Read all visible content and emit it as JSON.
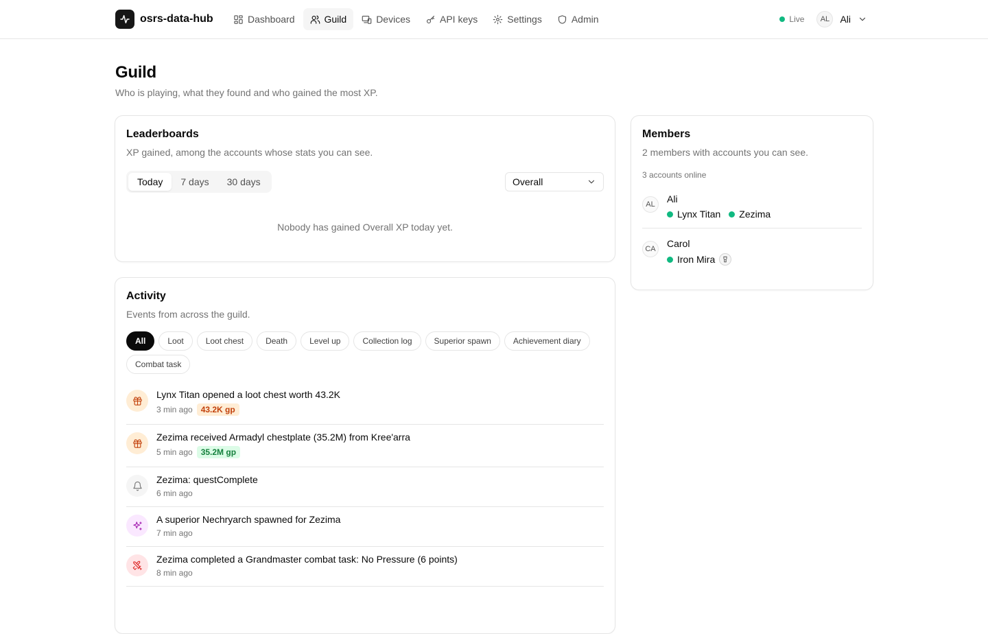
{
  "brand": {
    "name": "osrs-data-hub",
    "logo_icon": "activity-icon"
  },
  "nav": [
    {
      "label": "Dashboard",
      "icon": "grid-icon",
      "active": false
    },
    {
      "label": "Guild",
      "icon": "users-icon",
      "active": true
    },
    {
      "label": "Devices",
      "icon": "devices-icon",
      "active": false
    },
    {
      "label": "API keys",
      "icon": "key-icon",
      "active": false
    },
    {
      "label": "Settings",
      "icon": "gear-icon",
      "active": false
    },
    {
      "label": "Admin",
      "icon": "shield-icon",
      "active": false
    }
  ],
  "status": {
    "label": "Live",
    "color": "#10b981"
  },
  "user": {
    "initials": "AL",
    "name": "Ali"
  },
  "page": {
    "title": "Guild",
    "subtitle": "Who is playing, what they found and who gained the most XP."
  },
  "leaderboards": {
    "title": "Leaderboards",
    "description": "XP gained, among the accounts whose stats you can see.",
    "ranges": [
      "Today",
      "7 days",
      "30 days"
    ],
    "selected_range": "Today",
    "skill": "Overall",
    "empty": "Nobody has gained Overall XP today yet."
  },
  "activity": {
    "title": "Activity",
    "description": "Events from across the guild.",
    "filters": [
      "All",
      "Loot",
      "Loot chest",
      "Death",
      "Level up",
      "Collection log",
      "Superior spawn",
      "Achievement diary",
      "Combat task"
    ],
    "selected_filter": "All",
    "events": [
      {
        "text": "Lynx Titan opened a loot chest worth 43.2K",
        "time": "3 min ago",
        "badge": "43.2K gp",
        "icon": "gift-icon",
        "icon_bg": "#ffedd5",
        "icon_color": "#c2410c",
        "badge_bg": "#ffedd5",
        "badge_color": "#c2410c"
      },
      {
        "text": "Zezima received Armadyl chestplate (35.2M) from Kree'arra",
        "time": "5 min ago",
        "badge": "35.2M gp",
        "icon": "gift-icon",
        "icon_bg": "#ffedd5",
        "icon_color": "#c2410c",
        "badge_bg": "#dcfce7",
        "badge_color": "#15803d"
      },
      {
        "text": "Zezima: questComplete",
        "time": "6 min ago",
        "badge": "",
        "icon": "bell-icon",
        "icon_bg": "#f5f5f5",
        "icon_color": "#737373"
      },
      {
        "text": "A superior Nechryarch spawned for Zezima",
        "time": "7 min ago",
        "badge": "",
        "icon": "sparkles-icon",
        "icon_bg": "#fae8ff",
        "icon_color": "#a21caf"
      },
      {
        "text": "Zezima completed a Grandmaster combat task: No Pressure (6 points)",
        "time": "8 min ago",
        "badge": "",
        "icon": "swords-icon",
        "icon_bg": "#ffe4e6",
        "icon_color": "#dc2626"
      }
    ]
  },
  "members": {
    "title": "Members",
    "description": "2 members with accounts you can see.",
    "online": "3 accounts online",
    "list": [
      {
        "initials": "AL",
        "name": "Ali",
        "accounts": [
          {
            "name": "Lynx Titan",
            "ironman": false
          },
          {
            "name": "Zezima",
            "ironman": false
          }
        ]
      },
      {
        "initials": "CA",
        "name": "Carol",
        "accounts": [
          {
            "name": "Iron Mira",
            "ironman": true
          }
        ]
      }
    ]
  }
}
